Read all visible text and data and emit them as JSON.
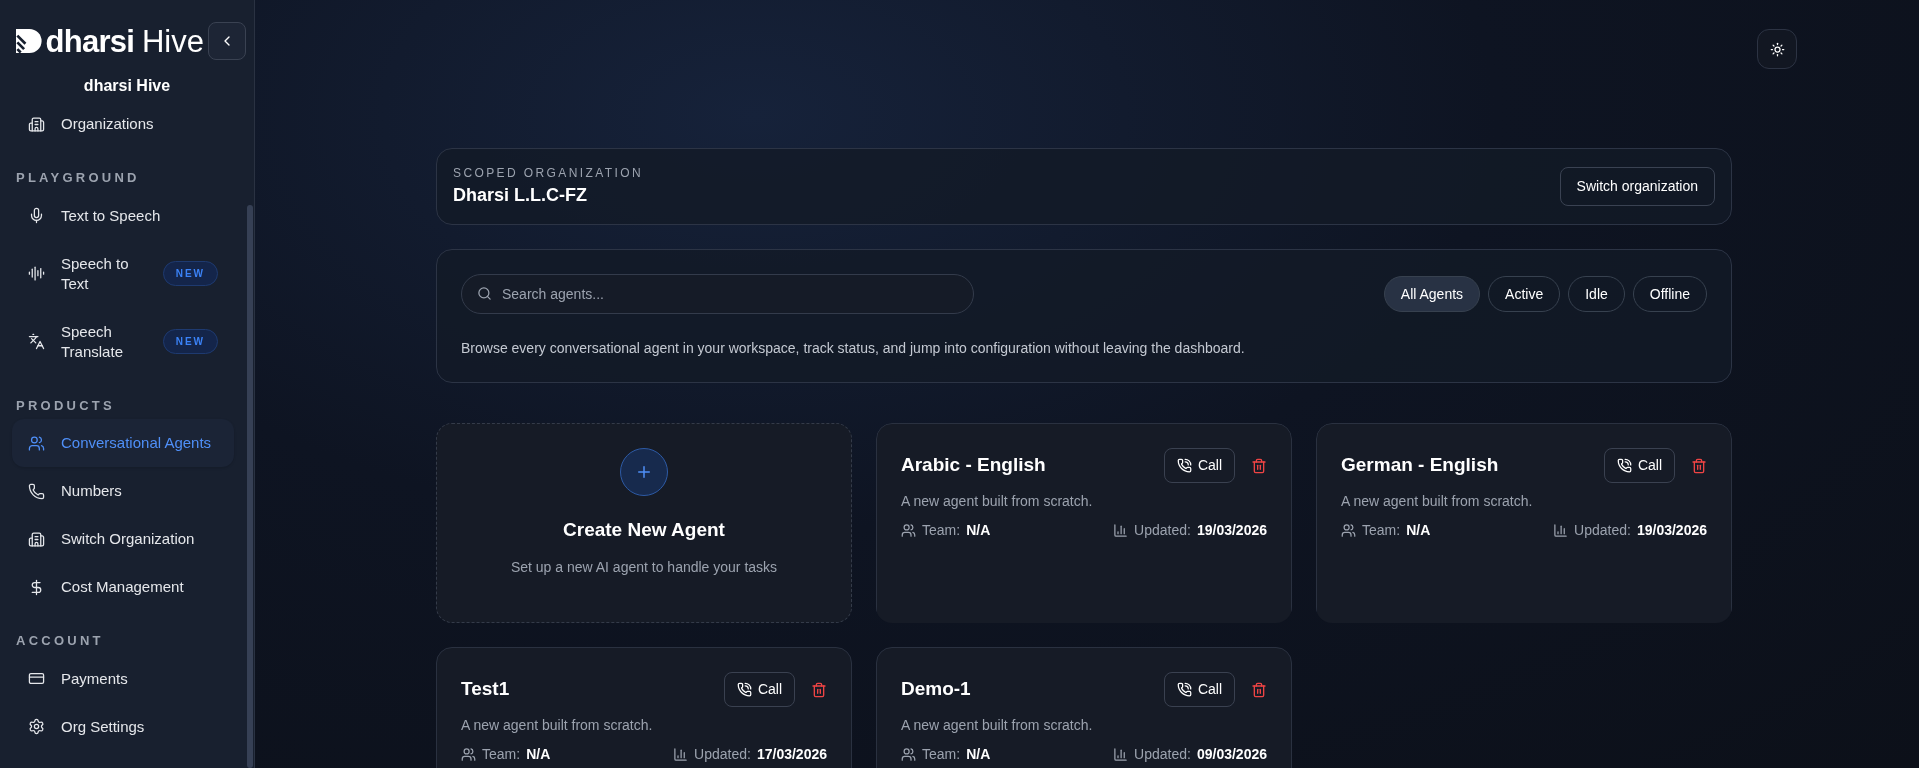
{
  "sidebar": {
    "logo": {
      "brand": "dharsi",
      "product": "Hive"
    },
    "app_name": "dharsi Hive",
    "top_items": [
      {
        "label": "Organizations",
        "selected": false
      }
    ],
    "sections": [
      {
        "heading": "PLAYGROUND",
        "items": [
          {
            "label": "Text to Speech",
            "selected": false
          },
          {
            "label": "Speech to Text",
            "badge": "NEW",
            "selected": false
          },
          {
            "label": "Speech Translate",
            "badge": "NEW",
            "selected": false
          }
        ]
      },
      {
        "heading": "PRODUCTS",
        "items": [
          {
            "label": "Conversational Agents",
            "selected": true
          },
          {
            "label": "Numbers",
            "selected": false
          },
          {
            "label": "Switch Organization",
            "selected": false
          },
          {
            "label": "Cost Management",
            "selected": false
          }
        ]
      },
      {
        "heading": "ACCOUNT",
        "items": [
          {
            "label": "Payments",
            "selected": false
          },
          {
            "label": "Org Settings",
            "selected": false
          }
        ]
      }
    ]
  },
  "scoped_org": {
    "label": "SCOPED ORGANIZATION",
    "name": "Dharsi L.L.C-FZ",
    "button": "Switch organization"
  },
  "filter": {
    "search_placeholder": "Search agents...",
    "tabs": [
      {
        "label": "All Agents",
        "selected": true
      },
      {
        "label": "Active",
        "selected": false
      },
      {
        "label": "Idle",
        "selected": false
      },
      {
        "label": "Offline",
        "selected": false
      }
    ],
    "description": "Browse every conversational agent in your workspace, track status, and jump into configuration without leaving the dashboard."
  },
  "create_card": {
    "title": "Create New Agent",
    "subtitle": "Set up a new AI agent to handle your tasks"
  },
  "agents": [
    {
      "name": "Arabic - English",
      "call": "Call",
      "description": "A new agent built from scratch.",
      "team_label": "Team:",
      "team": "N/A",
      "updated_label": "Updated:",
      "updated": "19/03/2026"
    },
    {
      "name": "German - English",
      "call": "Call",
      "description": "A new agent built from scratch.",
      "team_label": "Team:",
      "team": "N/A",
      "updated_label": "Updated:",
      "updated": "19/03/2026"
    },
    {
      "name": "Test1",
      "call": "Call",
      "description": "A new agent built from scratch.",
      "team_label": "Team:",
      "team": "N/A",
      "updated_label": "Updated:",
      "updated": "17/03/2026"
    },
    {
      "name": "Demo-1",
      "call": "Call",
      "description": "A new agent built from scratch.",
      "team_label": "Team:",
      "team": "N/A",
      "updated_label": "Updated:",
      "updated": "09/03/2026"
    }
  ]
}
